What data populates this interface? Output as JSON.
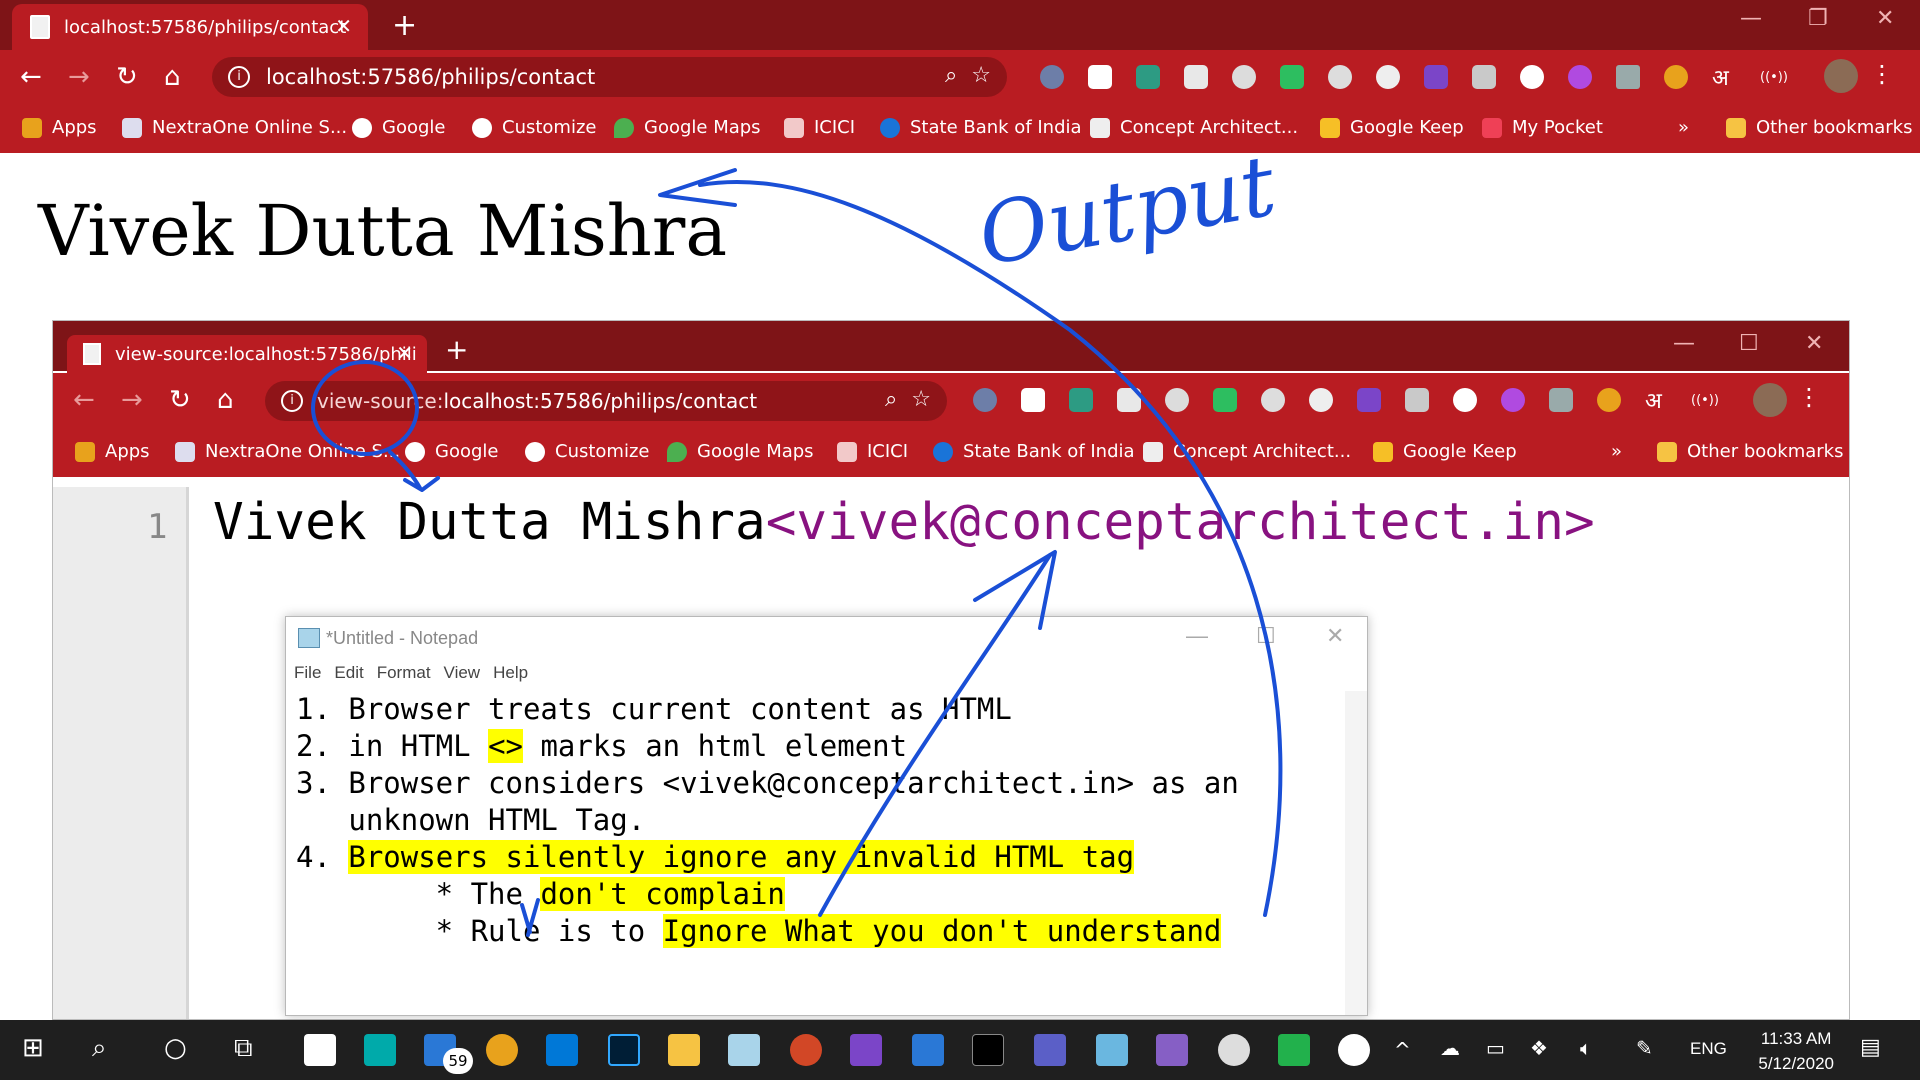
{
  "outer_browser": {
    "tab_title": "localhost:57586/philips/contact",
    "url": "localhost:57586/philips/contact",
    "bookmarks": [
      "Apps",
      "NextraOne Online S...",
      "Google",
      "Customize",
      "Google Maps",
      "ICICI",
      "State Bank of India",
      "Concept Architect...",
      "Google Keep",
      "My Pocket"
    ],
    "overflow": "»",
    "other_bookmarks": "Other bookmarks"
  },
  "page": {
    "heading": "Vivek Dutta Mishra"
  },
  "inner_browser": {
    "tab_title": "view-source:localhost:57586/phili",
    "url_prefix": "view-source:",
    "url_rest": "localhost:57586/philips/contact",
    "bookmarks": [
      "Apps",
      "NextraOne Online S...",
      "Google",
      "Customize",
      "Google Maps",
      "ICICI",
      "State Bank of India",
      "Concept Architect...",
      "Google Keep"
    ],
    "overflow": "»",
    "other_bookmarks": "Other bookmarks",
    "source": {
      "line_number": "1",
      "text": "Vivek Dutta Mishra",
      "tag": "<vivek@conceptarchitect.in>"
    }
  },
  "notepad": {
    "title": "*Untitled - Notepad",
    "menu": [
      "File",
      "Edit",
      "Format",
      "View",
      "Help"
    ],
    "lines": {
      "l1": "1. Browser treats current content as HTML",
      "l2a": "2. in HTML ",
      "l2b": "<>",
      "l2c": " marks an html element",
      "l3": "3. Browser considers <vivek@conceptarchitect.in> as an",
      "l4": "   unknown HTML Tag.",
      "l5a": "4. ",
      "l5b": "Browsers silently ignore any invalid HTML tag",
      "l6a": "        * The ",
      "l6b": "don't complain",
      "l7a": "        * Rule is to ",
      "l7b": "Ignore What you don't understand"
    }
  },
  "annotation": {
    "handwriting": "Output"
  },
  "taskbar": {
    "mail_badge": "59",
    "language": "ENG",
    "time": "11:33 AM",
    "date": "5/12/2020"
  },
  "colors": {
    "chrome_dark": "#7e1417",
    "chrome": "#b91c22",
    "tag_purple": "#881280",
    "highlight": "#ffff00",
    "ink": "#1a4fd6"
  }
}
